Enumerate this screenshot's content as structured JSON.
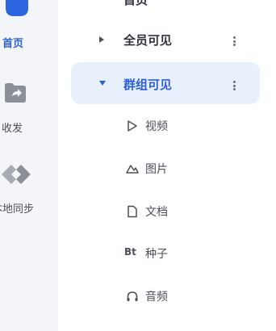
{
  "rail": {
    "items": [
      {
        "label": "首页",
        "icon": "home-icon"
      },
      {
        "label": "收发",
        "icon": "transfer-folder-icon"
      },
      {
        "label": "本地同步",
        "icon": "sync-icon"
      }
    ]
  },
  "tree": {
    "top_partial": "首页",
    "groups": [
      {
        "label": "全员可见",
        "expanded": false
      },
      {
        "label": "群组可见",
        "expanded": true
      }
    ],
    "filters": [
      {
        "label": "视频",
        "icon": "play-icon"
      },
      {
        "label": "图片",
        "icon": "image-icon"
      },
      {
        "label": "文档",
        "icon": "document-icon"
      },
      {
        "label": "种子",
        "icon": "torrent-icon",
        "glyph": "Bt"
      },
      {
        "label": "音频",
        "icon": "headphones-icon"
      }
    ]
  },
  "colors": {
    "accent": "#2b5fd9",
    "selected_bg": "#e8f0fc",
    "rail_bg": "#f3f5f8"
  }
}
